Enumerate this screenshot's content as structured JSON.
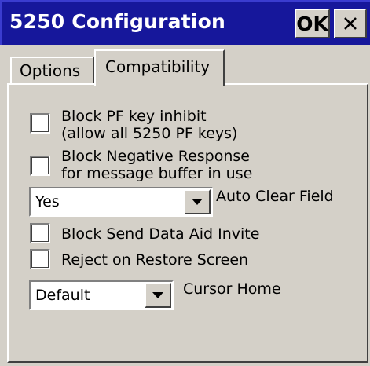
{
  "window": {
    "title": "5250 Configuration",
    "ok_label": "OK",
    "close_icon": "close-icon"
  },
  "tabs": [
    {
      "label": "Options",
      "active": false
    },
    {
      "label": "Compatibility",
      "active": true
    }
  ],
  "settings": {
    "block_pf": {
      "line1": "Block PF key inhibit",
      "line2": "(allow all 5250 PF keys)",
      "checked": false
    },
    "block_negative": {
      "line1": "Block Negative Response",
      "line2": "for message buffer in use",
      "checked": false
    },
    "auto_clear": {
      "value": "Yes",
      "label": "Auto Clear Field"
    },
    "block_send": {
      "label": "Block Send Data Aid Invite",
      "checked": false
    },
    "reject_restore": {
      "label": "Reject on Restore Screen",
      "checked": false
    },
    "cursor_home": {
      "value": "Default",
      "label": "Cursor Home"
    }
  },
  "colors": {
    "titlebar": "#16179b",
    "face": "#d4d0c8"
  }
}
